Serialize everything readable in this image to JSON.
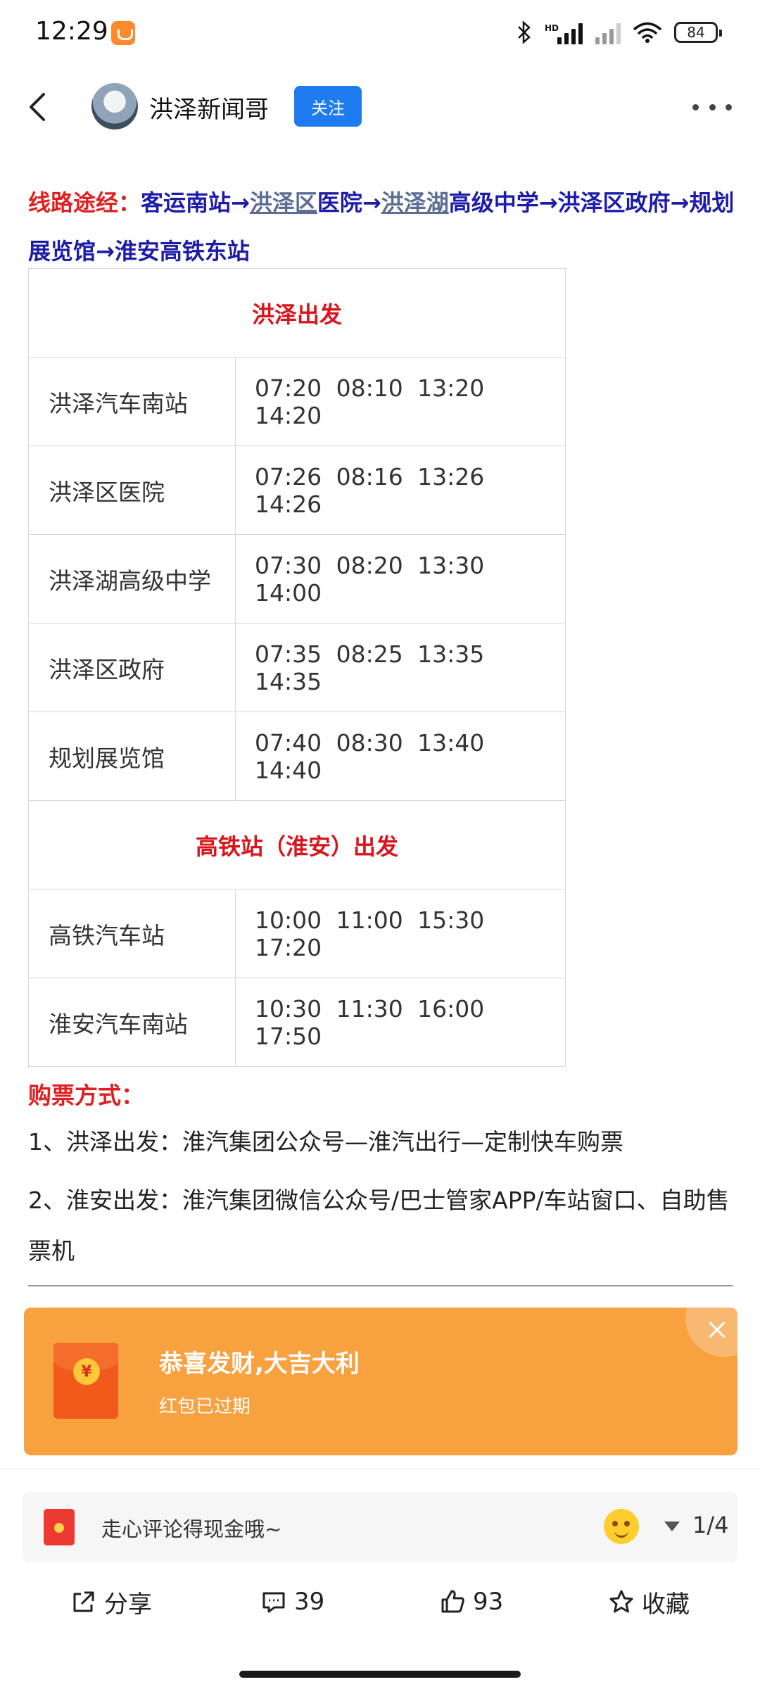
{
  "status": {
    "time": "12:29",
    "hd_label": "HD",
    "battery": "84",
    "icons": [
      "orange-app-icon",
      "bluetooth-icon",
      "signal-icon",
      "signal-weak-icon",
      "wifi-icon",
      "battery-icon"
    ]
  },
  "header": {
    "author": "洪泽新闻哥",
    "follow_label": "关注",
    "icons": [
      "back-icon",
      "more-icon"
    ]
  },
  "article": {
    "route_label": "线路途经：",
    "route_parts": {
      "p1": "客运南站→",
      "link1": "洪泽区",
      "p2": "医院→",
      "link2": "洪泽湖",
      "p3": "高级中学→洪泽区政府→规划展览馆→淮安高铁东站"
    },
    "schedule": {
      "section1": "洪泽出发",
      "rows1": [
        {
          "stop": "洪泽汽车南站",
          "times": "07:20 08:10 13:20 14:20"
        },
        {
          "stop": "洪泽区医院",
          "times": "07:26 08:16 13:26 14:26"
        },
        {
          "stop": "洪泽湖高级中学",
          "times": "07:30 08:20 13:30 14:00"
        },
        {
          "stop": "洪泽区政府",
          "times": "07:35 08:25 13:35 14:35"
        },
        {
          "stop": "规划展览馆",
          "times": "07:40 08:30 13:40 14:40"
        }
      ],
      "section2": "高铁站（淮安）出发",
      "rows2": [
        {
          "stop": "高铁汽车站",
          "times": "10:00 11:00 15:30 17:20"
        },
        {
          "stop": "淮安汽车南站",
          "times": "10:30 11:30 16:00 17:50"
        }
      ]
    },
    "buy_title": "购票方式：",
    "buy_item1": "1、洪泽出发：淮汽集团公众号—淮汽出行—定制快车购票",
    "buy_item2": "2、淮安出发：淮汽集团微信公众号/巴士管家APP/车站窗口、自助售票机"
  },
  "red_packet": {
    "title": "恭喜发财,大吉大利",
    "subtitle": "红包已过期",
    "coin_symbol": "¥",
    "colors": {
      "card": "#f7a13f",
      "envelope": "#f25a1c"
    }
  },
  "comment_bar": {
    "placeholder": "走心评论得现金哦~",
    "page": "1/4"
  },
  "actions": {
    "share": "分享",
    "comments": "39",
    "likes": "93",
    "favorite": "收藏"
  }
}
